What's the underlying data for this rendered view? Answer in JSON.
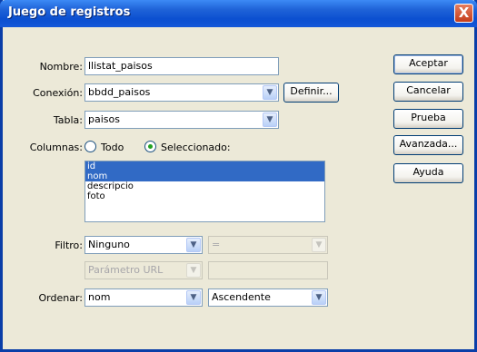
{
  "window": {
    "title": "Juego de registros",
    "close_glyph": "X"
  },
  "form": {
    "nombre": {
      "label": "Nombre:",
      "value": "llistat_paisos"
    },
    "conexion": {
      "label": "Conexión:",
      "value": "bbdd_paisos",
      "define_button": "Definir..."
    },
    "tabla": {
      "label": "Tabla:",
      "value": "paisos"
    },
    "columnas": {
      "label": "Columnas:",
      "option_all": "Todo",
      "option_selected": "Seleccionado:",
      "selected_option": "Seleccionado:",
      "items": [
        {
          "label": "id",
          "selected": true
        },
        {
          "label": "nom",
          "selected": true
        },
        {
          "label": "descripcio",
          "selected": false
        },
        {
          "label": "foto",
          "selected": false
        }
      ]
    },
    "filtro": {
      "label": "Filtro:",
      "value": "Ninguno",
      "operator": "=",
      "param": "Parámetro URL",
      "param_value": ""
    },
    "ordenar": {
      "label": "Ordenar:",
      "field": "nom",
      "direction": "Ascendente"
    }
  },
  "buttons": {
    "accept": "Aceptar",
    "cancel": "Cancelar",
    "test": "Prueba",
    "advanced": "Avanzada...",
    "help": "Ayuda"
  },
  "icons": {
    "dropdown": "chevron-down-icon",
    "close": "close-icon"
  },
  "colors": {
    "titlebar": "#0b4fd0",
    "window_bg": "#ece9d8",
    "selection": "#316ac5",
    "radio_dot": "#21a121"
  }
}
